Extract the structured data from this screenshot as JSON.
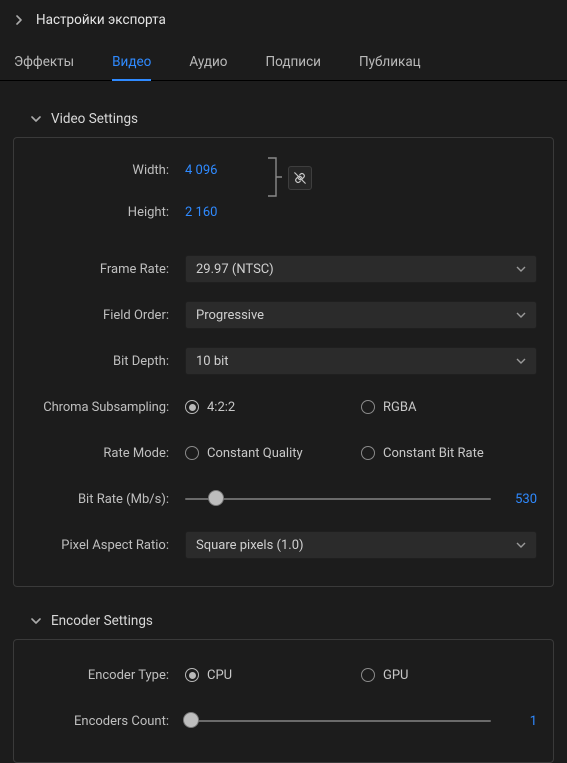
{
  "header": {
    "title": "Настройки экспорта"
  },
  "tabs": {
    "t0": "Эффекты",
    "t1": "Видео",
    "t2": "Аудио",
    "t3": "Подписи",
    "t4": "Публикац"
  },
  "video": {
    "section_title": "Video Settings",
    "width_label": "Width:",
    "width_val": "4 096",
    "height_label": "Height:",
    "height_val": "2 160",
    "fr_label": "Frame Rate:",
    "fr_val": "29.97 (NTSC)",
    "fo_label": "Field Order:",
    "fo_val": "Progressive",
    "bd_label": "Bit Depth:",
    "bd_val": "10 bit",
    "cs_label": "Chroma Subsampling:",
    "cs_opt1": "4:2:2",
    "cs_opt2": "RGBA",
    "rm_label": "Rate Mode:",
    "rm_opt1": "Constant Quality",
    "rm_opt2": "Constant Bit Rate",
    "br_label": "Bit Rate (Mb/s):",
    "br_val": "530",
    "par_label": "Pixel Aspect Ratio:",
    "par_val": "Square pixels (1.0)"
  },
  "encoder": {
    "section_title": "Encoder Settings",
    "type_label": "Encoder Type:",
    "type_opt1": "CPU",
    "type_opt2": "GPU",
    "count_label": "Encoders Count:",
    "count_val": "1"
  }
}
